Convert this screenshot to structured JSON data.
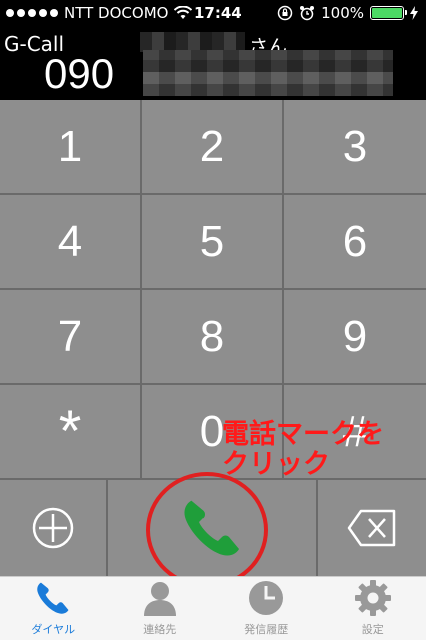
{
  "status_bar": {
    "carrier": "NTT DOCOMO",
    "time": "17:44",
    "battery": "100%",
    "battery_level": 1.0
  },
  "header": {
    "app_name": "G-Call",
    "name_suffix": "さん",
    "number_prefix": "090"
  },
  "keypad": {
    "keys": [
      "1",
      "2",
      "3",
      "4",
      "5",
      "6",
      "7",
      "8",
      "9",
      "*",
      "0",
      "#"
    ]
  },
  "annotation": {
    "text": "電話マークを\nクリック",
    "color": "#ff1a1a"
  },
  "tabs": [
    {
      "label": "ダイヤル",
      "icon": "phone-icon",
      "active": true
    },
    {
      "label": "連絡先",
      "icon": "person-icon",
      "active": false
    },
    {
      "label": "発信履歴",
      "icon": "clock-icon",
      "active": false
    },
    {
      "label": "設定",
      "icon": "gear-icon",
      "active": false
    }
  ],
  "colors": {
    "key_bg": "#8e8e8e",
    "call_green": "#1f9e3a",
    "active_tab": "#1a7bd9"
  }
}
